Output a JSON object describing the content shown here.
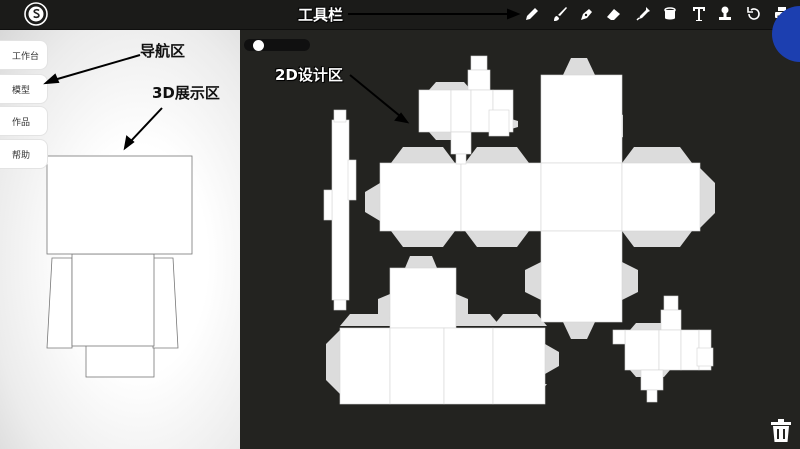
{
  "nav": {
    "items": [
      {
        "label": "工作台"
      },
      {
        "label": "模型"
      },
      {
        "label": "作品"
      },
      {
        "label": "帮助"
      }
    ]
  },
  "annotations": {
    "toolbar": "工具栏",
    "nav_area": "导航区",
    "display_3d": "3D展示区",
    "design_2d": "2D设计区"
  },
  "toolbar": {
    "tools": [
      "pencil-icon",
      "brush-icon",
      "pen-icon",
      "eraser-icon",
      "eyedropper-icon",
      "bucket-icon",
      "text-icon",
      "stamp-icon",
      "undo-icon",
      "print-icon"
    ]
  },
  "colors": {
    "topbar": "#1b1b19",
    "canvas": "#232320",
    "panel": "#ffffff",
    "accent": "#1c3fb0"
  }
}
